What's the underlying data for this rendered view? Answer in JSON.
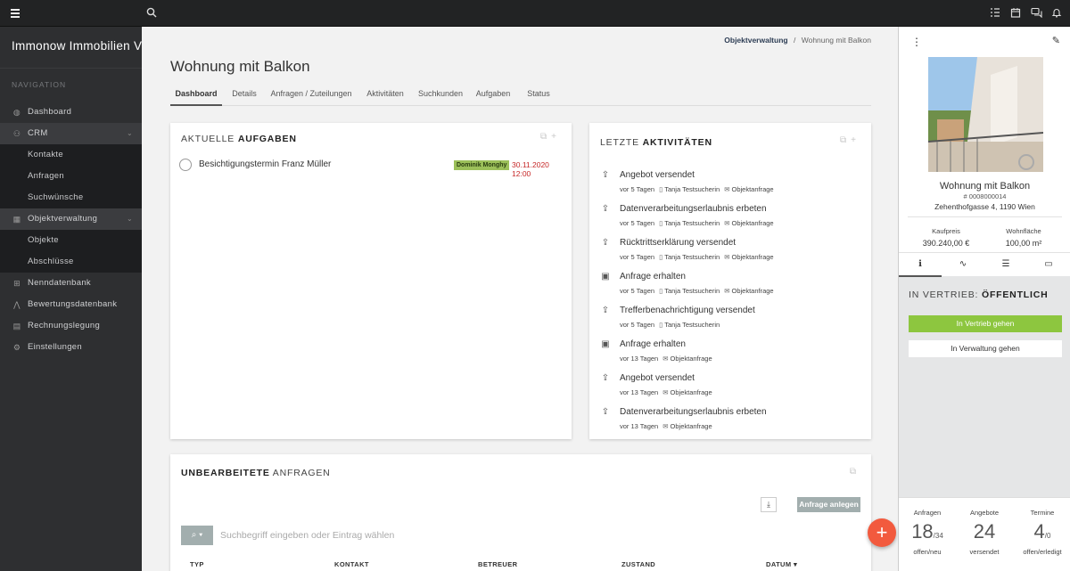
{
  "sidebar": {
    "brand": "Immonow Immobilien V...",
    "section": "NAVIGATION",
    "items": {
      "dashboard": "Dashboard",
      "crm": "CRM",
      "kontakte": "Kontakte",
      "anfragen": "Anfragen",
      "suchwuensche": "Suchwünsche",
      "objektverwaltung": "Objektverwaltung",
      "objekte": "Objekte",
      "abschluesse": "Abschlüsse",
      "nenndatenbank": "Nenndatenbank",
      "bewertungsdatenbank": "Bewertungsdatenbank",
      "rechnungslegung": "Rechnungslegung",
      "einstellungen": "Einstellungen"
    }
  },
  "breadcrumb": {
    "parent": "Objektverwaltung",
    "sep": "/",
    "current": "Wohnung mit Balkon"
  },
  "page_title": "Wohnung mit Balkon",
  "tabs": [
    "Dashboard",
    "Details",
    "Anfragen / Zuteilungen",
    "Aktivitäten",
    "Suchkunden",
    "Aufgaben",
    "Status"
  ],
  "tasks_card": {
    "title_light": "AKTUELLE",
    "title_bold": "AUFGABEN",
    "task": {
      "text": "Besichtigungstermin Franz Müller",
      "assignee": "Dominik Monghy",
      "due": "30.11.2020 12:00"
    }
  },
  "activities_card": {
    "title_light": "LETZTE",
    "title_bold": "AKTIVITÄTEN",
    "items": [
      {
        "title": "Angebot versendet",
        "time": "vor 5 Tagen",
        "user": "Tanja Testsucherin",
        "type": "Objektanfrage"
      },
      {
        "title": "Datenverarbeitungserlaubnis erbeten",
        "time": "vor 5 Tagen",
        "user": "Tanja Testsucherin",
        "type": "Objektanfrage"
      },
      {
        "title": "Rücktrittserklärung versendet",
        "time": "vor 5 Tagen",
        "user": "Tanja Testsucherin",
        "type": "Objektanfrage"
      },
      {
        "title": "Anfrage erhalten",
        "time": "vor 5 Tagen",
        "user": "Tanja Testsucherin",
        "type": "Objektanfrage"
      },
      {
        "title": "Trefferbenachrichtigung versendet",
        "time": "vor 5 Tagen",
        "user": "Tanja Testsucherin",
        "type": ""
      },
      {
        "title": "Anfrage erhalten",
        "time": "vor 13 Tagen",
        "user": "",
        "type": "Objektanfrage"
      },
      {
        "title": "Angebot versendet",
        "time": "vor 13 Tagen",
        "user": "",
        "type": "Objektanfrage"
      },
      {
        "title": "Datenverarbeitungserlaubnis erbeten",
        "time": "vor 13 Tagen",
        "user": "",
        "type": "Objektanfrage"
      }
    ]
  },
  "requests_card": {
    "title_bold": "UNBEARBEITETE",
    "title_light": "ANFRAGEN",
    "add_button": "Anfrage anlegen",
    "search_placeholder": "Suchbegriff eingeben oder Eintrag wählen",
    "columns": {
      "typ": "TYP",
      "kontakt": "KONTAKT",
      "betreuer": "BETREUER",
      "zustand": "ZUSTAND",
      "datum": "DATUM"
    }
  },
  "property": {
    "title": "Wohnung mit Balkon",
    "id": "# 0008000014",
    "address": "Zehenthofgasse 4, 1190 Wien",
    "price_label": "Kaufpreis",
    "price": "390.240,00 €",
    "area_label": "Wohnfläche",
    "area": "100,00 m²"
  },
  "status": {
    "prefix": "IN VERTRIEB:",
    "value": "ÖFFENTLICH",
    "btn_vertrieb": "In Vertrieb gehen",
    "btn_verwaltung": "In Verwaltung gehen"
  },
  "stats": [
    {
      "label": "Anfragen",
      "value": "18",
      "sub": "/34",
      "caption": "offen/neu"
    },
    {
      "label": "Angebote",
      "value": "24",
      "sub": "",
      "caption": "versendet"
    },
    {
      "label": "Termine",
      "value": "4",
      "sub": "/0",
      "caption": "offen/erledigt"
    }
  ],
  "colors": {
    "accent_green": "#8dc63f",
    "fab_red": "#f25a3e",
    "badge_green": "#9cc05a",
    "due_red": "#c62828"
  },
  "icons": {
    "menu": "hamburger-icon",
    "search": "search-icon",
    "tasks": "checklist-icon",
    "calendar": "calendar-icon",
    "chat": "chat-icon",
    "bell": "bell-icon",
    "fab": "plus-icon"
  }
}
